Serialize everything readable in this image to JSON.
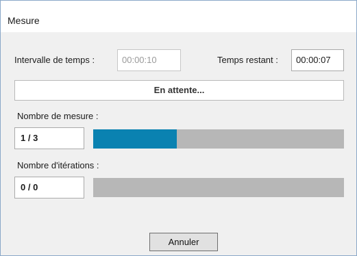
{
  "window": {
    "title": "Mesure"
  },
  "time": {
    "interval_label": "Intervalle de temps :",
    "interval_value": "00:00:10",
    "remaining_label": "Temps restant :",
    "remaining_value": "00:00:07"
  },
  "status": {
    "text": "En attente..."
  },
  "measures": {
    "label": "Nombre de mesure :",
    "value": "1 / 3",
    "progress": 0.3333
  },
  "iterations": {
    "label": "Nombre d'itérations :",
    "value": "0 / 0",
    "progress": 0
  },
  "buttons": {
    "cancel": "Annuler"
  },
  "colors": {
    "progress_fill": "#0a82b1",
    "progress_track": "#b7b7b7",
    "window_border": "#8aa8c8"
  }
}
